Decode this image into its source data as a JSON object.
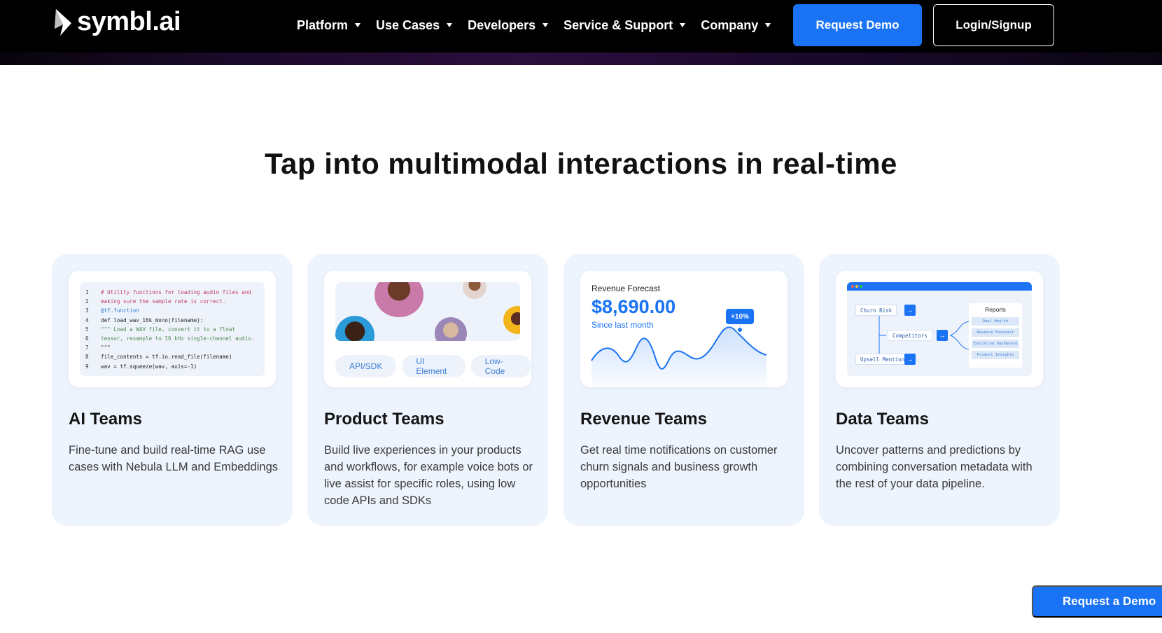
{
  "nav": {
    "logo_text": "symbl.ai",
    "menu": [
      {
        "label": "Platform"
      },
      {
        "label": "Use Cases"
      },
      {
        "label": "Developers"
      },
      {
        "label": "Service & Support"
      },
      {
        "label": "Company"
      }
    ],
    "demo_button": "Request Demo",
    "login_button": "Login/Signup"
  },
  "headline": "Tap into multimodal interactions in real-time",
  "cards": [
    {
      "title": "AI Teams",
      "description": "Fine-tune and build real-time RAG use cases with Nebula LLM and Embeddings",
      "code_lines": [
        {
          "n": "1",
          "text": "# Utility functions for loading audio files and"
        },
        {
          "n": "2",
          "text": "making sure the sample rate is correct."
        },
        {
          "n": "3",
          "text": "@tf.function"
        },
        {
          "n": "4",
          "text": "def load_wav_16k_mono(filename):"
        },
        {
          "n": "5",
          "text": "    \"\"\" Load a WAV file, convert it to a float"
        },
        {
          "n": "6",
          "text": "tensor, resample to 16 kHz single-channel audio."
        },
        {
          "n": "7",
          "text": "\"\"\""
        },
        {
          "n": "8",
          "text": "    file_contents = tf.io.read_file(filename)"
        },
        {
          "n": "9",
          "text": "wav = tf.squeeze(wav, axis=-1)"
        }
      ]
    },
    {
      "title": "Product Teams",
      "description": "Build live experiences in your products and workflows, for example voice bots or live assist for specific roles, using low code APIs and SDKs",
      "chips": [
        "API/SDK",
        "UI Element",
        "Low-Code"
      ]
    },
    {
      "title": "Revenue Teams",
      "description": "Get real time notifications on customer churn signals and business growth opportunities",
      "forecast_label": "Revenue Forecast",
      "forecast_value": "$8,690.00",
      "forecast_sub": "Since last month",
      "forecast_badge": "+10%"
    },
    {
      "title": "Data Teams",
      "description": "Uncover patterns and predictions by combining conversation metadata with the rest of your data pipeline.",
      "nodes": [
        "Churn Risk",
        "Competitors",
        "Upsell Mention"
      ],
      "reports_title": "Reports",
      "reports": [
        "Deal Health",
        "Revenue Forecast",
        "Executive Dashboard",
        "Product Insights"
      ]
    }
  ],
  "float_button": "Request a Demo",
  "colors": {
    "accent": "#1a73f5",
    "nav_bg": "#000000",
    "card_bg": "#eef4fd"
  }
}
